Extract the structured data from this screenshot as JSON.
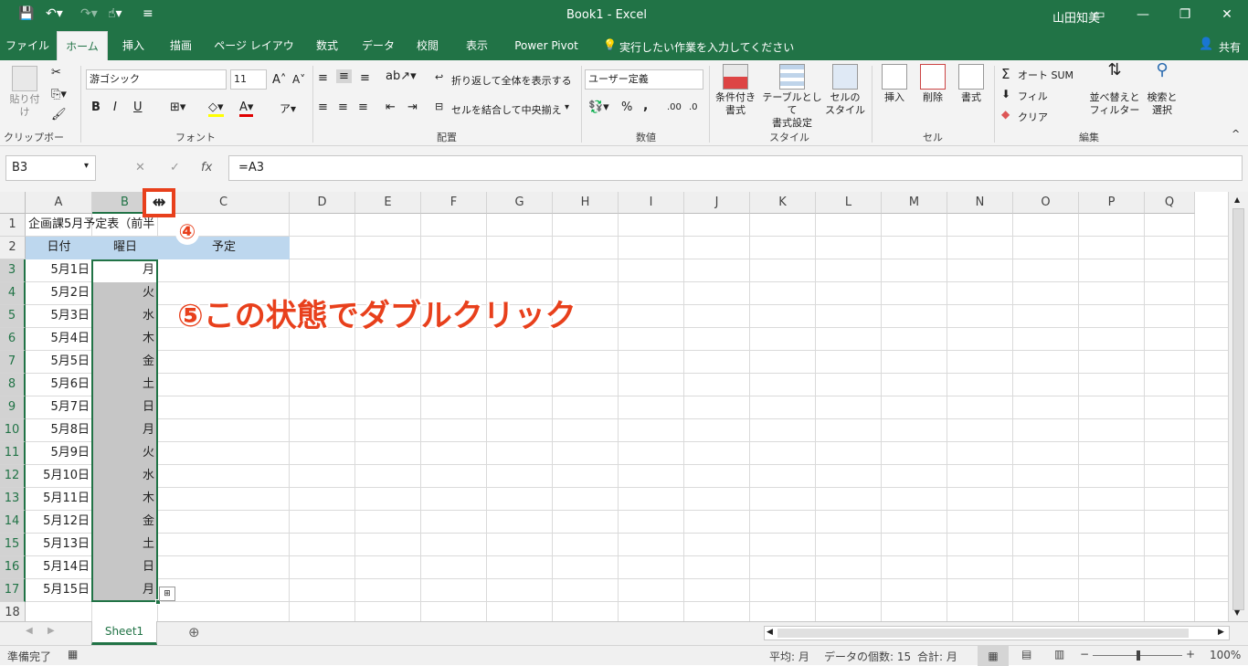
{
  "titlebar": {
    "title": "Book1  -  Excel",
    "user": "山田知美",
    "share": "共有"
  },
  "tabs": [
    "ファイル",
    "ホーム",
    "挿入",
    "描画",
    "ページ レイアウト",
    "数式",
    "データ",
    "校閲",
    "表示",
    "Power Pivot"
  ],
  "tell_me": "実行したい作業を入力してください",
  "ribbon": {
    "clipboard": {
      "paste": "貼り付け",
      "label": "クリップボード"
    },
    "font": {
      "name": "游ゴシック",
      "size": "11",
      "bold": "B",
      "italic": "I",
      "underline": "U",
      "label": "フォント"
    },
    "alignment": {
      "wrap": "折り返して全体を表示する",
      "merge": "セルを結合して中央揃え",
      "label": "配置"
    },
    "number": {
      "format": "ユーザー定義",
      "percent": "%",
      "comma": ",",
      "label": "数値"
    },
    "styles": {
      "cond1": "条件付き",
      "cond2": "書式",
      "table1": "テーブルとして",
      "table2": "書式設定",
      "cell1": "セルの",
      "cell2": "スタイル",
      "label": "スタイル"
    },
    "cells": {
      "insert": "挿入",
      "delete": "削除",
      "format": "書式",
      "label": "セル"
    },
    "editing": {
      "autosum": "オート SUM",
      "fill": "フィル",
      "clear": "クリア",
      "sort1": "並べ替えと",
      "sort2": "フィルター",
      "find1": "検索と",
      "find2": "選択",
      "label": "編集"
    }
  },
  "formula_bar": {
    "name_box": "B3",
    "formula": "=A3"
  },
  "columns": [
    "A",
    "B",
    "C",
    "D",
    "E",
    "F",
    "G",
    "H",
    "I",
    "J",
    "K",
    "L",
    "M",
    "N",
    "O",
    "P",
    "Q"
  ],
  "rows": [
    "1",
    "2",
    "3",
    "4",
    "5",
    "6",
    "7",
    "8",
    "9",
    "10",
    "11",
    "12",
    "13",
    "14",
    "15",
    "16",
    "17",
    "18"
  ],
  "cells": {
    "a1": "企画課5月予定表（前半",
    "a2": "日付",
    "b2": "曜日",
    "c2": "予定",
    "dates": [
      "5月1日",
      "5月2日",
      "5月3日",
      "5月4日",
      "5月5日",
      "5月6日",
      "5月7日",
      "5月8日",
      "5月9日",
      "5月10日",
      "5月11日",
      "5月12日",
      "5月13日",
      "5月14日",
      "5月15日"
    ],
    "days": [
      "月",
      "火",
      "水",
      "木",
      "金",
      "土",
      "日",
      "月",
      "火",
      "水",
      "木",
      "金",
      "土",
      "日",
      "月"
    ]
  },
  "annotations": {
    "step4": "④",
    "step5": "⑤この状態でダブルクリック"
  },
  "sheet_tab": "Sheet1",
  "statusbar": {
    "ready": "準備完了",
    "average": "平均: 月",
    "count": "データの個数: 15",
    "sum": "合計: 月",
    "zoom": "100%"
  },
  "colors": {
    "excel_green": "#217346",
    "header_fill": "#bdd7ee",
    "selection": "#c6c6c6",
    "annotation_red": "#e8401c"
  }
}
